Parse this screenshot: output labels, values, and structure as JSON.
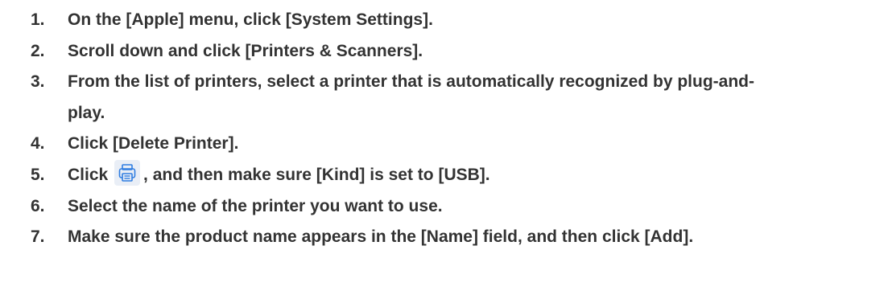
{
  "steps": [
    {
      "number": "1.",
      "text": "On the [Apple] menu, click [System Settings]."
    },
    {
      "number": "2.",
      "text": "Scroll down and click [Printers & Scanners]."
    },
    {
      "number": "3.",
      "text": "From the list of printers, select a printer that is automatically recognized by plug-and-play."
    },
    {
      "number": "4.",
      "text": "Click [Delete Printer]."
    },
    {
      "number": "5.",
      "text_before": "Click",
      "icon": "add-printer-icon",
      "text_after": ", and then make sure [Kind] is set to [USB]."
    },
    {
      "number": "6.",
      "text": "Select the name of the printer you want to use."
    },
    {
      "number": "7.",
      "text": "Make sure the product name appears in the [Name] field, and then click [Add]."
    }
  ],
  "colors": {
    "text": "#333333",
    "icon_background": "#e9eef6",
    "icon_accent": "#2f7de1"
  }
}
